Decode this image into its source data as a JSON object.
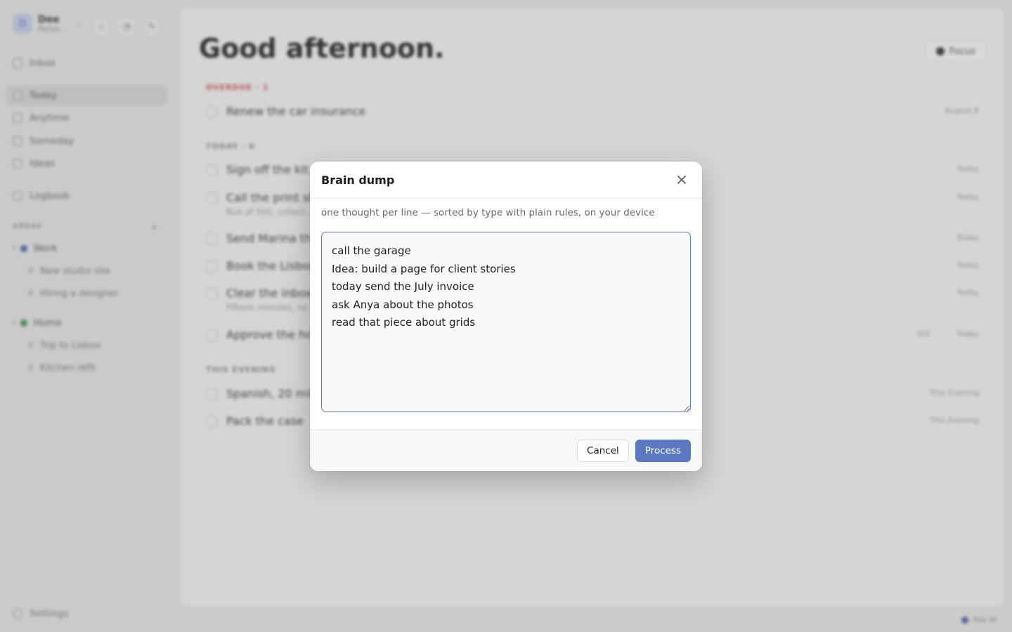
{
  "sidebar": {
    "workspace": {
      "initial": "D",
      "name": "Dee",
      "subtitle": "Perso..."
    },
    "nav": [
      {
        "label": "Inbox"
      },
      {
        "label": "Today"
      },
      {
        "label": "Anytime"
      },
      {
        "label": "Someday"
      },
      {
        "label": "Ideas"
      },
      {
        "label": "Logbook"
      }
    ],
    "areas_heading": "AREAS",
    "areas": [
      {
        "label": "Work",
        "color": "#4a63b8",
        "projects": [
          "New studio site",
          "Hiring a designer"
        ]
      },
      {
        "label": "Home",
        "color": "#3a9a4a",
        "projects": [
          "Trip to Lisbon",
          "Kitchen refit"
        ]
      }
    ],
    "settings_label": "Settings"
  },
  "main": {
    "greeting": "Good afternoon.",
    "focus_label": "Focus",
    "overdue_heading": "OVERDUE · 1",
    "today_heading": "TODAY · 6",
    "evening_heading": "THIS EVENING",
    "tasks": [
      {
        "title": "Renew the car insurance",
        "sub": "",
        "meta": "August 8"
      },
      {
        "title": "Sign off the kit...",
        "sub": "",
        "meta": "Today"
      },
      {
        "title": "Call the print sh...",
        "sub": "Run of 500, collect...",
        "meta": "Today"
      },
      {
        "title": "Send Marina the...",
        "sub": "",
        "meta": "Today"
      },
      {
        "title": "Book the Lisbon...",
        "sub": "",
        "meta": "Today"
      },
      {
        "title": "Clear the inbox...",
        "sub": "Fifteen minutes, ne...",
        "meta": "Today"
      },
      {
        "title": "Approve the ho...",
        "sub": "",
        "meta": "Today",
        "extra": "0/3"
      },
      {
        "title": "Spanish, 20 min...",
        "sub": "",
        "meta": "This Evening"
      },
      {
        "title": "Pack the case",
        "sub": "",
        "meta": "This Evening"
      }
    ],
    "ask_ai": "Ask AI"
  },
  "modal": {
    "title": "Brain dump",
    "hint": "one thought per line — sorted by type with plain rules, on your device",
    "text": "call the garage\nIdea: build a page for client stories\ntoday send the July invoice\nask Anya about the photos\nread that piece about grids",
    "cancel_label": "Cancel",
    "process_label": "Process",
    "accent": "#5b78c0"
  }
}
